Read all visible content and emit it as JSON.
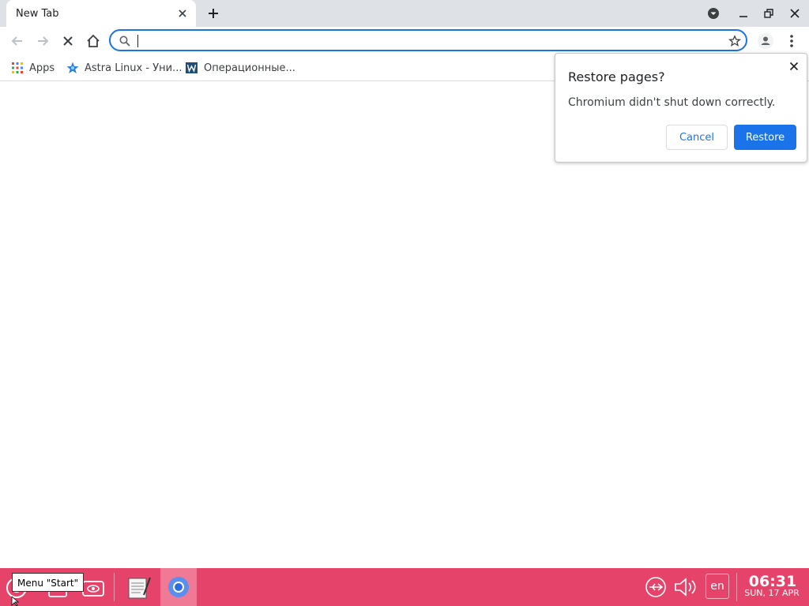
{
  "tabs": [
    {
      "title": "New Tab"
    }
  ],
  "toolbar": {
    "omnibox_value": ""
  },
  "bookmarks": [
    {
      "label": "Apps",
      "icon": "apps-grid-icon"
    },
    {
      "label": "Astra Linux - Уни...",
      "icon": "astra-star-icon"
    },
    {
      "label": "Операционные...",
      "icon": "w-logo-icon"
    }
  ],
  "dialog": {
    "title": "Restore pages?",
    "message": "Chromium didn't shut down correctly.",
    "cancel_label": "Cancel",
    "restore_label": "Restore"
  },
  "taskbar": {
    "tooltip": "Menu \"Start\"",
    "language": "en",
    "time": "06:31",
    "date": "SUN, 17 APR"
  },
  "colors": {
    "accent": "#1a73e8",
    "taskbar": "#e6436a",
    "tabstrip": "#dee1e6"
  }
}
